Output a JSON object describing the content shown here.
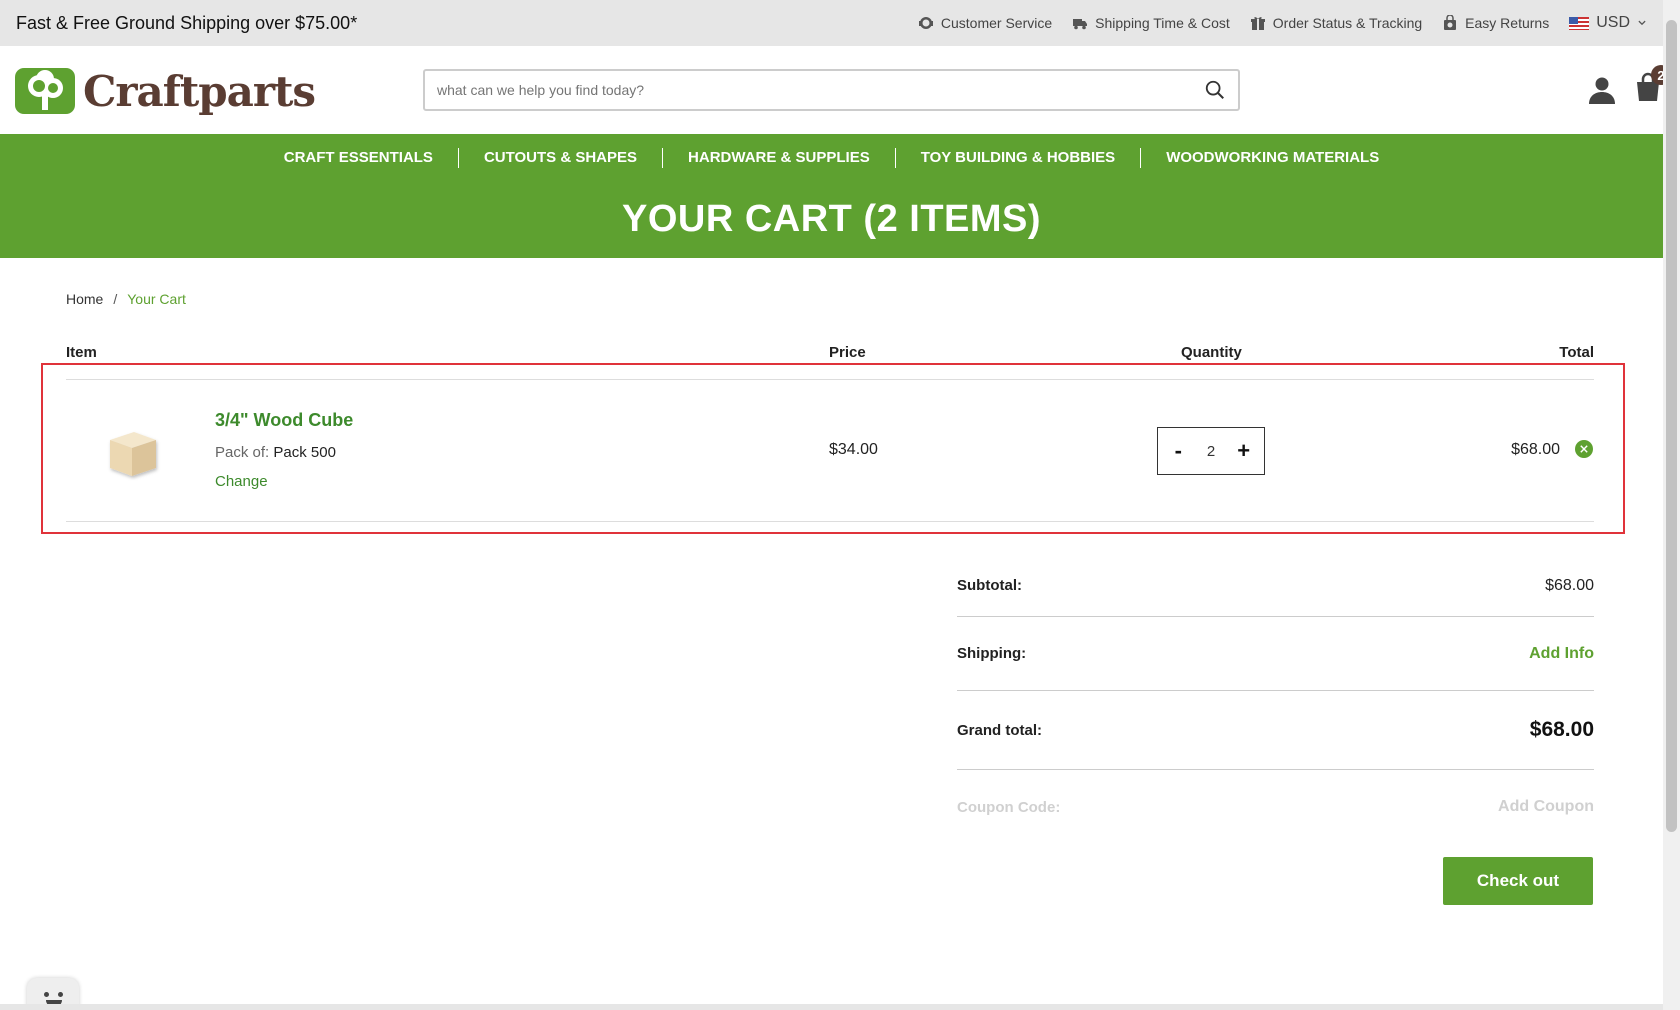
{
  "topbar": {
    "promo": "Fast & Free Ground Shipping over $75.00*",
    "links": [
      {
        "label": "Customer Service",
        "icon": "headset-icon"
      },
      {
        "label": "Shipping Time & Cost",
        "icon": "truck-icon"
      },
      {
        "label": "Order Status & Tracking",
        "icon": "gift-icon"
      },
      {
        "label": "Easy Returns",
        "icon": "return-bag-icon"
      }
    ],
    "currency": "USD"
  },
  "header": {
    "logo_text": "Craftparts",
    "search_placeholder": "what can we help you find today?",
    "cart_count": "2"
  },
  "nav": {
    "items": [
      "CRAFT ESSENTIALS",
      "CUTOUTS & SHAPES",
      "HARDWARE & SUPPLIES",
      "TOY BUILDING & HOBBIES",
      "WOODWORKING MATERIALS"
    ]
  },
  "page": {
    "title": "YOUR CART (2 ITEMS)"
  },
  "breadcrumb": {
    "home": "Home",
    "separator": "/",
    "current": "Your Cart"
  },
  "cart_table": {
    "headers": {
      "item": "Item",
      "price": "Price",
      "quantity": "Quantity",
      "total": "Total"
    },
    "rows": [
      {
        "name": "3/4\" Wood Cube",
        "option_label": "Pack of:",
        "option_value": "Pack 500",
        "change_label": "Change",
        "price": "$34.00",
        "quantity": "2",
        "total": "$68.00"
      }
    ]
  },
  "summary": {
    "subtotal_label": "Subtotal:",
    "subtotal_value": "$68.00",
    "shipping_label": "Shipping:",
    "shipping_value": "Add Info",
    "grand_total_label": "Grand total:",
    "grand_total_value": "$68.00",
    "coupon_label": "Coupon Code:",
    "coupon_value": "Add Coupon"
  },
  "checkout_label": "Check out",
  "colors": {
    "brand_green": "#5ea130",
    "link_green": "#3d8a2c",
    "logo_brown": "#5a3d33",
    "highlight_red": "#e0333a"
  }
}
